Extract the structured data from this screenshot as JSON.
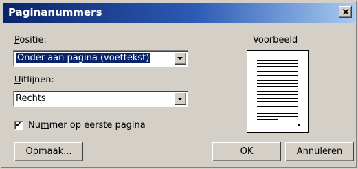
{
  "dialog": {
    "title": "Paginanummers",
    "close_icon": "close-icon"
  },
  "position": {
    "label_key": "P",
    "label_rest": "ositie:",
    "value": "Onder aan pagina (voettekst)"
  },
  "align": {
    "label_key": "U",
    "label_rest": "itlijnen:",
    "value": "Rechts"
  },
  "first_page": {
    "label_pre": "Nu",
    "label_key": "m",
    "label_rest": "mer op eerste pagina",
    "checked": true
  },
  "preview": {
    "label": "Voorbeeld"
  },
  "buttons": {
    "format_key": "O",
    "format_rest": "pmaak...",
    "ok": "OK",
    "cancel": "Annuleren"
  }
}
